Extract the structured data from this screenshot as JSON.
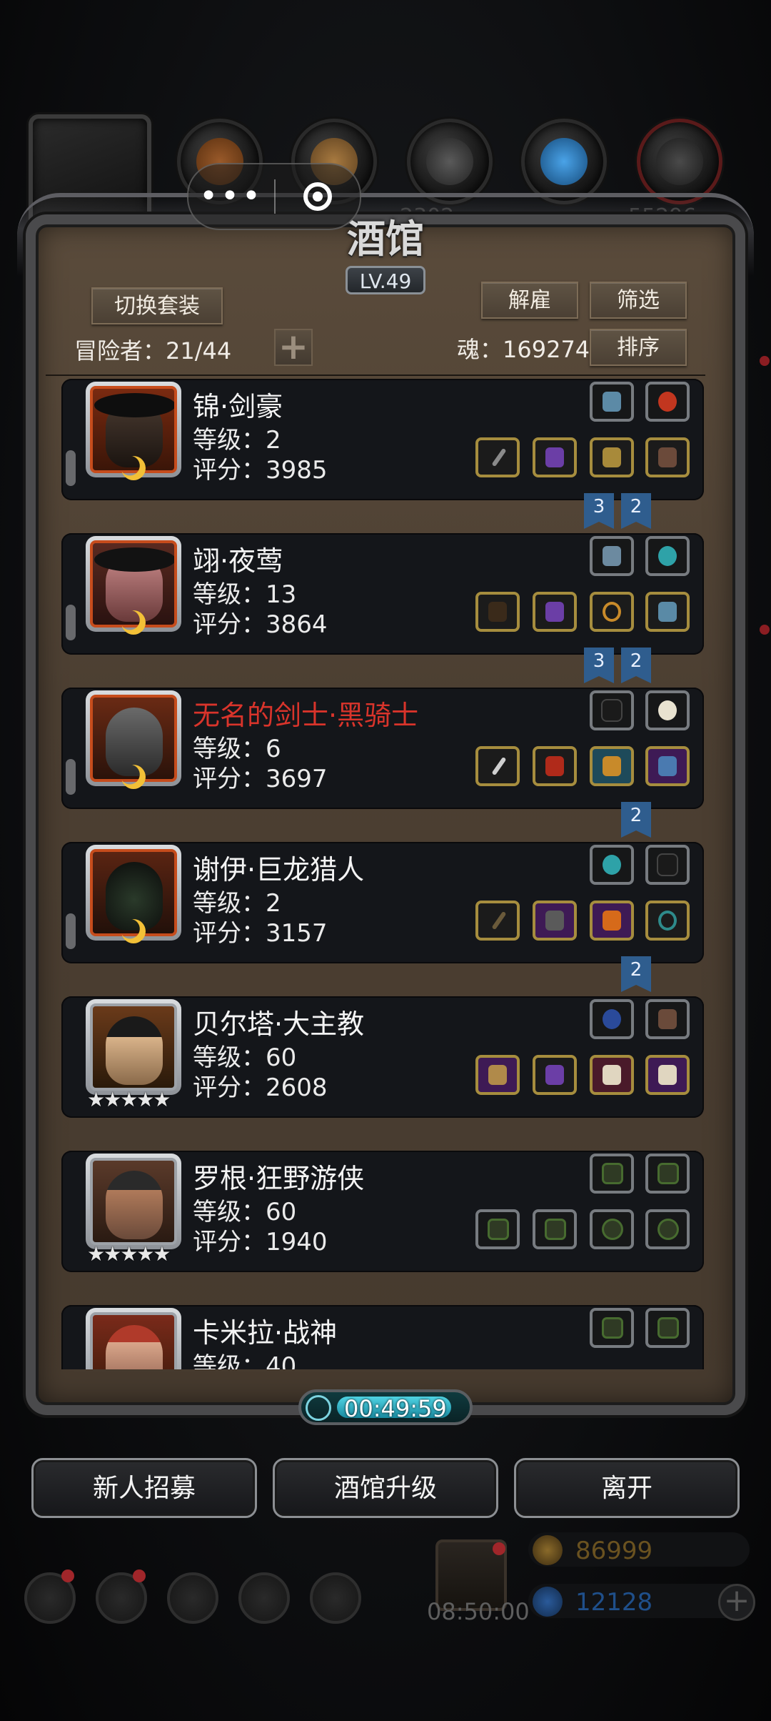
{
  "top_bar": {
    "icons": [
      "tavern-portrait-icon",
      "wood-resource-icon",
      "leather-resource-icon",
      "iron-ingot-icon",
      "crystal-icon",
      "steel-ingot-icon"
    ],
    "dim_numbers": [
      "2302",
      "55296"
    ]
  },
  "capsule": {
    "more": "•••"
  },
  "panel": {
    "title": "酒馆",
    "level": "LV.49",
    "switch_outfit": "切换套装",
    "dismiss": "解雇",
    "filter": "筛选",
    "adventurers": "冒险者：21/44",
    "soul": "魂：169274",
    "sort": "排序"
  },
  "heroes": [
    {
      "name": "锦·剑豪",
      "level": "等级：2",
      "score": "评分：3985",
      "red": false,
      "ribbons": [
        "3",
        "2"
      ]
    },
    {
      "name": "翊·夜莺",
      "level": "等级：13",
      "score": "评分：3864",
      "red": false,
      "ribbons": [
        "3",
        "2"
      ]
    },
    {
      "name": "无名的剑士·黑骑士",
      "level": "等级：6",
      "score": "评分：3697",
      "red": true,
      "ribbons": [
        "2"
      ]
    },
    {
      "name": "谢伊·巨龙猎人",
      "level": "等级：2",
      "score": "评分：3157",
      "red": false,
      "ribbons": [
        "2"
      ]
    },
    {
      "name": "贝尔塔·大主教",
      "level": "等级：60",
      "score": "评分：2608",
      "red": false,
      "stars": "★★★★★"
    },
    {
      "name": "罗根·狂野游侠",
      "level": "等级：60",
      "score": "评分：1940",
      "red": false,
      "stars": "★★★★★"
    },
    {
      "name": "卡米拉·战神",
      "level": "等级：40",
      "score": "",
      "red": false
    }
  ],
  "timer": "00:49:59",
  "actions": {
    "recruit": "新人招募",
    "upgrade": "酒馆升级",
    "leave": "离开"
  },
  "bottom": {
    "gift_timer": "08:50:00",
    "gold": "86999",
    "gems": "12128"
  },
  "colors": {
    "name_red": "#d9342b",
    "slot_gold": "#a68d3e",
    "ribbon_blue": "#2f5d8e"
  }
}
